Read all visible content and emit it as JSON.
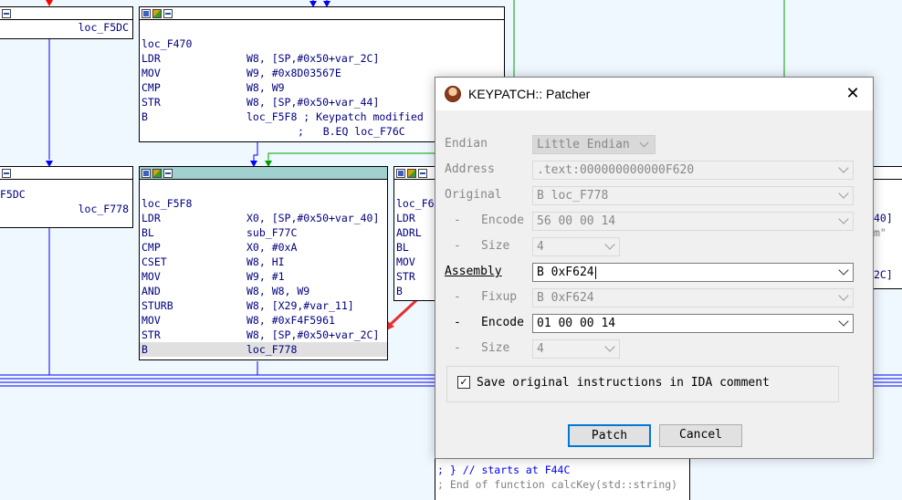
{
  "graph": {
    "node_left_top": {
      "value": "loc_F5DC"
    },
    "node_left_mid": {
      "label": "F5DC",
      "value": "loc_F778"
    },
    "node_top": {
      "label": "loc_F470",
      "rows": [
        {
          "mn": "LDR",
          "op": "W8, [SP,#0x50+var_2C]"
        },
        {
          "mn": "MOV",
          "op": "W9, #0x8D03567E"
        },
        {
          "mn": "CMP",
          "op": "W8, W9"
        },
        {
          "mn": "STR",
          "op": "W8, [SP,#0x50+var_44]"
        },
        {
          "mn": "B",
          "op": "loc_F5F8 ; Keypatch modified"
        }
      ],
      "continuation": ";   B.EQ loc_F76C"
    },
    "node_main": {
      "label": "loc_F5F8",
      "rows": [
        {
          "mn": "LDR",
          "op": "X0, [SP,#0x50+var_40]"
        },
        {
          "mn": "BL",
          "op": "sub_F77C"
        },
        {
          "mn": "CMP",
          "op": "X0, #0xA"
        },
        {
          "mn": "CSET",
          "op": "W8, HI"
        },
        {
          "mn": "MOV",
          "op": "W9, #1"
        },
        {
          "mn": "AND",
          "op": "W8, W8, W9"
        },
        {
          "mn": "STURB",
          "op": "W8, [X29,#var_11]"
        },
        {
          "mn": "MOV",
          "op": "W8, #0xF4F5961"
        },
        {
          "mn": "STR",
          "op": "W8, [SP,#0x50+var_2C]"
        },
        {
          "mn": "B",
          "op": "loc_F778"
        }
      ]
    },
    "node_right": {
      "label": "loc_F6",
      "mnemonics": [
        "LDR",
        "ADRL",
        "BL",
        "MOV",
        "STR",
        "B"
      ],
      "right_fragments": [
        "40]",
        "m\"",
        "2C]"
      ]
    },
    "bottom_node": {
      "line1": "; } // starts at F44C",
      "line2": "; End of function calcKey(std::string)"
    }
  },
  "dialog": {
    "title": "KEYPATCH:: Patcher",
    "close_glyph": "✕",
    "fields": {
      "endian": {
        "label": "Endian",
        "value": "Little Endian"
      },
      "address": {
        "label": "Address",
        "value": ".text:000000000000F620"
      },
      "original": {
        "label": "Original",
        "value": "B loc_F778"
      },
      "orig_encode": {
        "prefix": "-",
        "label": "Encode",
        "value": "56 00 00 14"
      },
      "orig_size": {
        "prefix": "-",
        "label": "Size",
        "value": "4"
      },
      "assembly": {
        "label": "Assembly",
        "value": "B 0xF624"
      },
      "fixup": {
        "prefix": "-",
        "label": "Fixup",
        "value": "B 0xF624"
      },
      "encode": {
        "prefix": "-",
        "label": "Encode",
        "value": "01 00 00 14"
      },
      "size": {
        "prefix": "-",
        "label": "Size",
        "value": "4"
      }
    },
    "save_comment": {
      "label": "Save original instructions in IDA comment",
      "checked": true,
      "check_glyph": "✓"
    },
    "patch_button": "Patch",
    "cancel_button": "Cancel"
  },
  "colors": {
    "background": "#f0f8ff",
    "edge_blue": "#0000ff",
    "edge_green": "#00a000",
    "edge_red": "#ff0000",
    "arrow_red": "#e53030",
    "selected_header": "#a0d0d0"
  }
}
